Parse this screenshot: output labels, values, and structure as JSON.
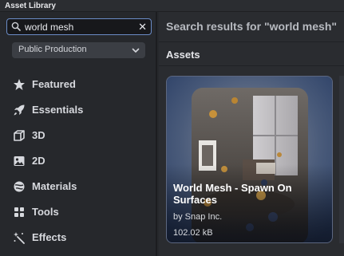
{
  "window": {
    "title": "Asset Library"
  },
  "search": {
    "value": "world mesh",
    "clear_glyph": "✕"
  },
  "filter": {
    "selected": "Public Production"
  },
  "nav": [
    {
      "label": "Featured",
      "icon": "star-icon"
    },
    {
      "label": "Essentials",
      "icon": "rocket-icon"
    },
    {
      "label": "3D",
      "icon": "cube-icon"
    },
    {
      "label": "2D",
      "icon": "image-icon"
    },
    {
      "label": "Materials",
      "icon": "materials-icon"
    },
    {
      "label": "Tools",
      "icon": "tools-icon"
    },
    {
      "label": "Effects",
      "icon": "effects-icon"
    }
  ],
  "results": {
    "heading": "Search results for \"world mesh\"",
    "section": "Assets"
  },
  "card": {
    "title": "World Mesh - Spawn On Surfaces",
    "author": "by Snap Inc.",
    "size": "102.02 kB"
  },
  "colors": {
    "accent": "#6b8cc7",
    "sidebar": "#26282c",
    "main": "#2a2c30"
  }
}
